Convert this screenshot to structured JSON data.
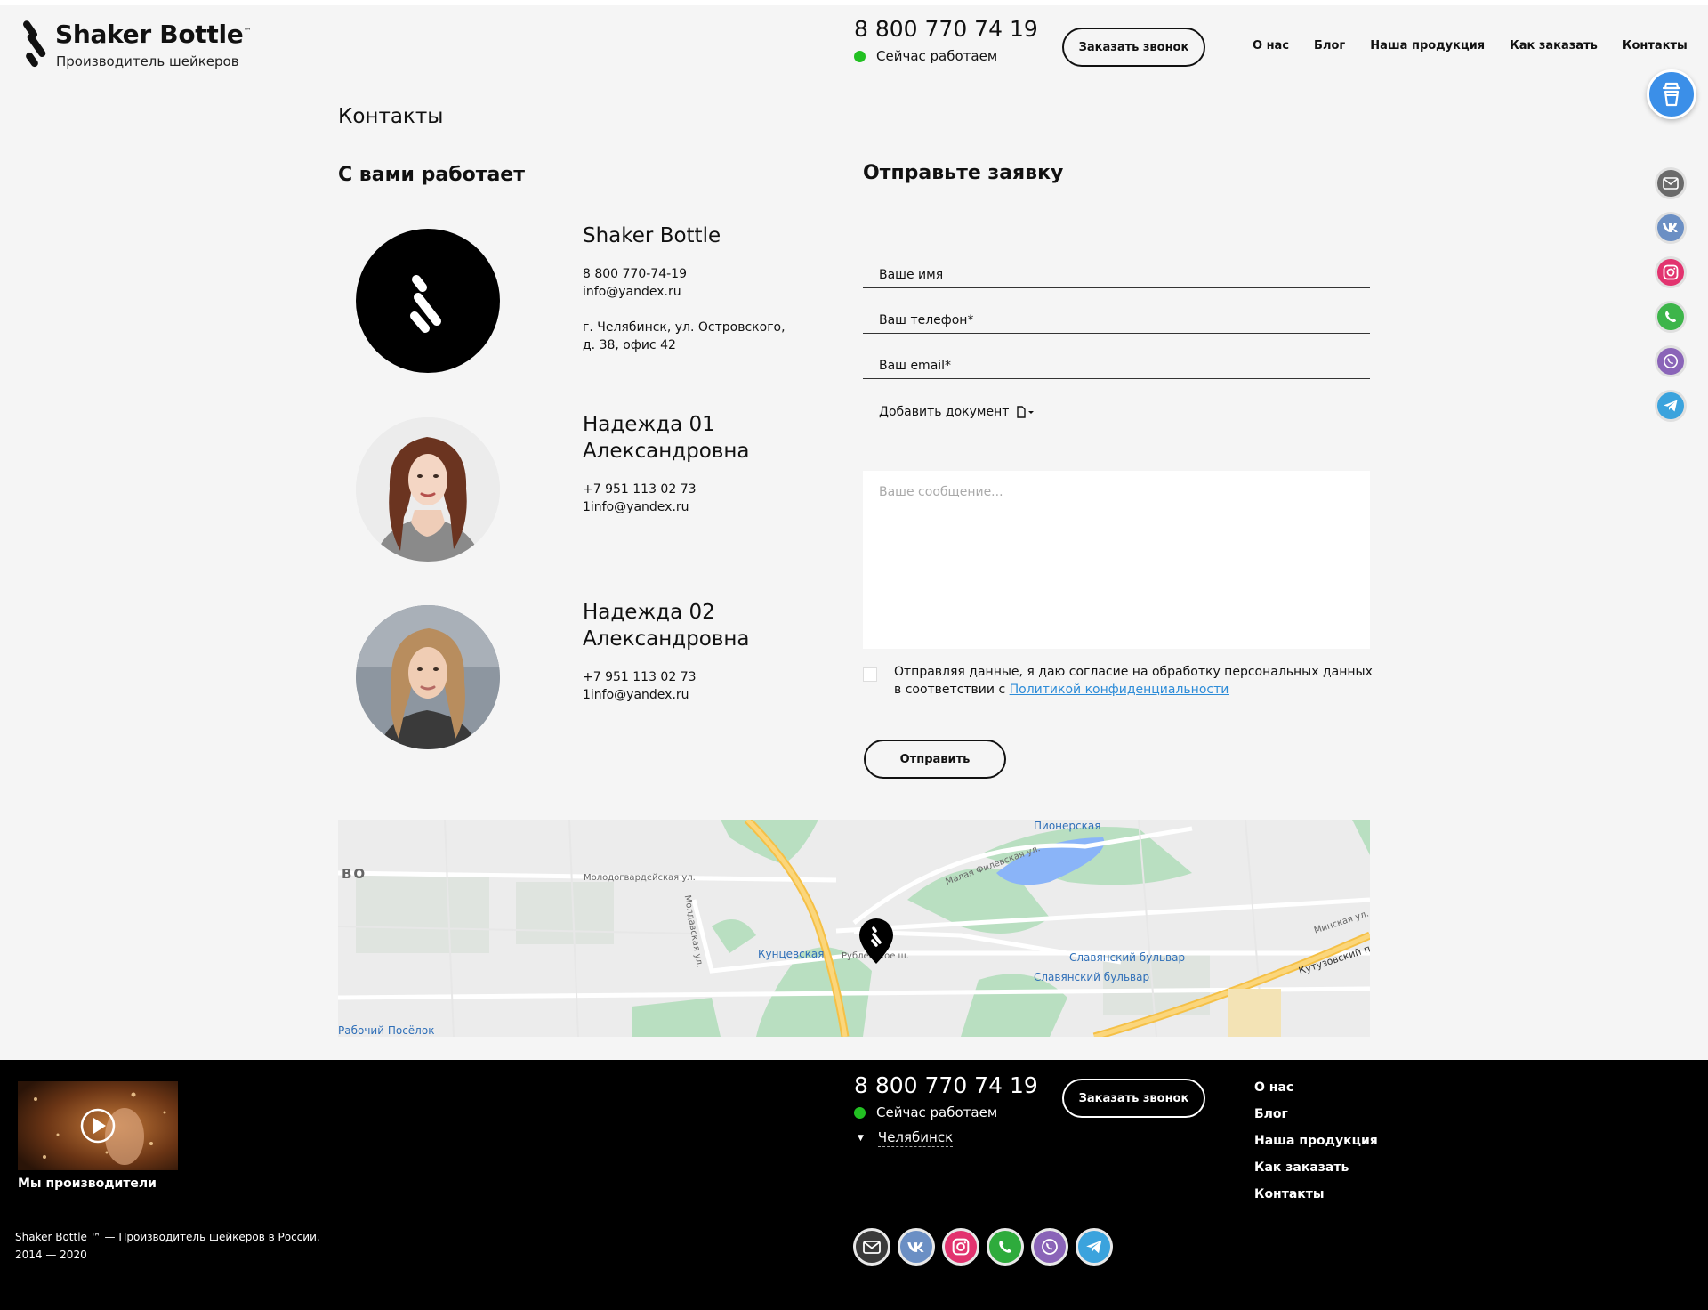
{
  "header": {
    "logo_title": "Shaker Bottle",
    "logo_tm": "™",
    "logo_subtitle": "Производитель шейкеров",
    "phone": "8 800 770 74 19",
    "status": "Сейчас работаем",
    "callback_button": "Заказать звонок",
    "nav": [
      "О нас",
      "Блог",
      "Наша продукция",
      "Как заказать",
      "Контакты"
    ]
  },
  "floating": {
    "cart_icon": "shaker-cup-icon",
    "social_icons": [
      "mail-icon",
      "vk-icon",
      "instagram-icon",
      "whatsapp-icon",
      "viber-icon",
      "telegram-icon"
    ]
  },
  "colors": {
    "accent_blue": "#3b8fe8",
    "status_green": "#22c022",
    "link": "#2d8cd8",
    "mail": "#6a6a6a",
    "vk": "#6b8fc4",
    "instagram": "#e2336f",
    "whatsapp": "#3db54a",
    "viber": "#8a64b8",
    "telegram": "#3ba3dd"
  },
  "main": {
    "page_title": "Контакты",
    "contacts_heading": "С вами работает",
    "form_heading": "Отправьте заявку",
    "contacts": [
      {
        "name": "Shaker Bottle",
        "phone": "8 800 770-74-19",
        "email": "info@yandex.ru",
        "address_line1": "г. Челябинск, ул. Островского,",
        "address_line2": "д. 38, офис 42"
      },
      {
        "name_line1": "Надежда 01",
        "name_line2": "Александровна",
        "phone": "+7 951 113 02 73",
        "email": "1info@yandex.ru"
      },
      {
        "name_line1": "Надежда 02",
        "name_line2": "Александровна",
        "phone": "+7 951 113 02 73",
        "email": "1info@yandex.ru"
      }
    ],
    "form": {
      "name_label": "Ваше имя",
      "phone_label": "Ваш телефон*",
      "email_label": "Ваш email*",
      "document_label": "Добавить документ",
      "message_placeholder": "Ваше сообщение...",
      "consent_text": "Отправляя данные, я даю согласие на обработку персональных данных в соответствии с ",
      "consent_link": "Политикой конфиденциальности",
      "submit": "Отправить"
    },
    "map": {
      "labels": {
        "pionerskaya": "Пионерская",
        "molodogvardeyskaya": "Молодогвардейская ул.",
        "malaya_filevskaya": "Малая Филевская ул.",
        "moldavskaya": "Молдавская ул.",
        "kuntsevskaya": "Кунцевская",
        "rublevskoe": "Рублевское ш.",
        "slavyansky_1": "Славянский бульвар",
        "slavyansky_2": "Славянский бульвар",
        "minskaya": "Минская ул.",
        "kutuzovsky": "Кутузовский пр",
        "rabochiy": "Рабочий Посёлок",
        "edge": "ВО"
      }
    }
  },
  "footer": {
    "video_caption": "Мы производители",
    "copyright_line1": "Shaker Bottle ™ — Производитель шейкеров в России.",
    "copyright_line2": "2014 — 2020",
    "phone": "8 800 770 74 19",
    "status": "Сейчас работаем",
    "city": "Челябинск",
    "callback_button": "Заказать звонок",
    "nav": [
      "О нас",
      "Блог",
      "Наша продукция",
      "Как заказать",
      "Контакты"
    ]
  }
}
